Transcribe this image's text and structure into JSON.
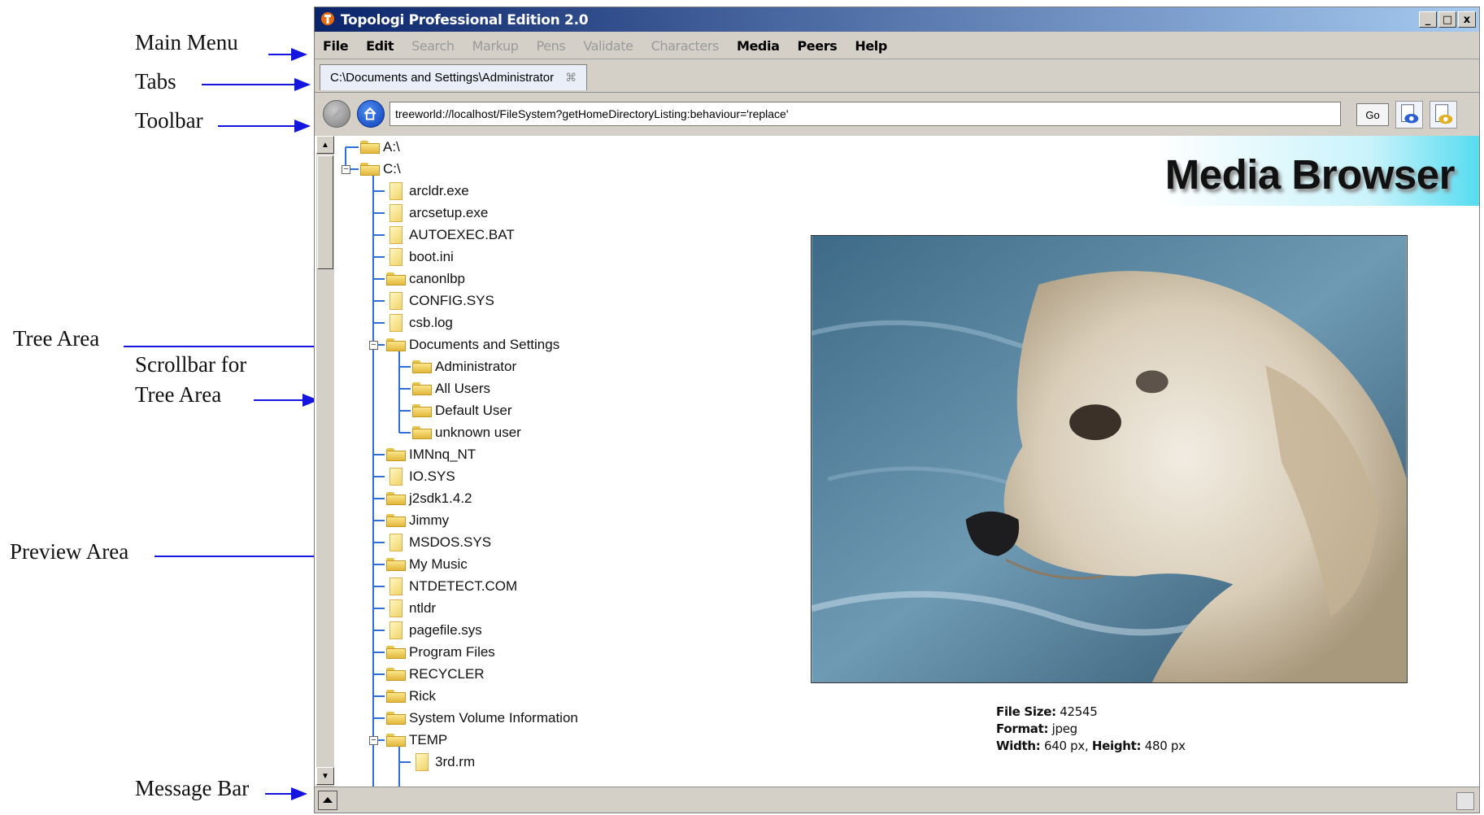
{
  "annotations": {
    "main_menu": "Main Menu",
    "tabs": "Tabs",
    "toolbar": "Toolbar",
    "tree_area": "Tree Area",
    "scrollbar_line1": "Scrollbar for",
    "scrollbar_line2": "Tree Area",
    "preview_area": "Preview Area",
    "message_bar": "Message Bar"
  },
  "window": {
    "title": "Topologi Professional Edition 2.0",
    "controls": {
      "minimize": "_",
      "maximize": "□",
      "close": "x"
    }
  },
  "menu": {
    "file": "File",
    "edit": "Edit",
    "search": "Search",
    "markup": "Markup",
    "pens": "Pens",
    "validate": "Validate",
    "characters": "Characters",
    "media": "Media",
    "peers": "Peers",
    "help": "Help"
  },
  "tab": {
    "label": "C:\\Documents and Settings\\Administrator",
    "close": "⌘"
  },
  "toolbar": {
    "url": "treeworld://localhost/FileSystem?getHomeDirectoryListing:behaviour='replace'",
    "go": "Go"
  },
  "tree": {
    "drive_a": "A:\\",
    "drive_c": "C:\\",
    "c_items": [
      "arcldr.exe",
      "arcsetup.exe",
      "AUTOEXEC.BAT",
      "boot.ini",
      "canonlbp",
      "CONFIG.SYS",
      "csb.log",
      "Documents and Settings"
    ],
    "docs_items": [
      "Administrator",
      "All Users",
      "Default User",
      "unknown user"
    ],
    "c_items2": [
      "IMNnq_NT",
      "IO.SYS",
      "j2sdk1.4.2",
      "Jimmy",
      "MSDOS.SYS",
      "My Music",
      "NTDETECT.COM",
      "ntldr",
      "pagefile.sys",
      "Program Files",
      "RECYCLER",
      "Rick",
      "System Volume Information",
      "TEMP"
    ],
    "temp_items": [
      "3rd.rm"
    ]
  },
  "preview": {
    "banner_title": "Media Browser",
    "file_size_label": "File Size:",
    "file_size_value": "42545",
    "format_label": "Format:",
    "format_value": "jpeg",
    "width_label": "Width:",
    "width_value": "640 px,",
    "height_label": "Height:",
    "height_value": "480 px"
  }
}
